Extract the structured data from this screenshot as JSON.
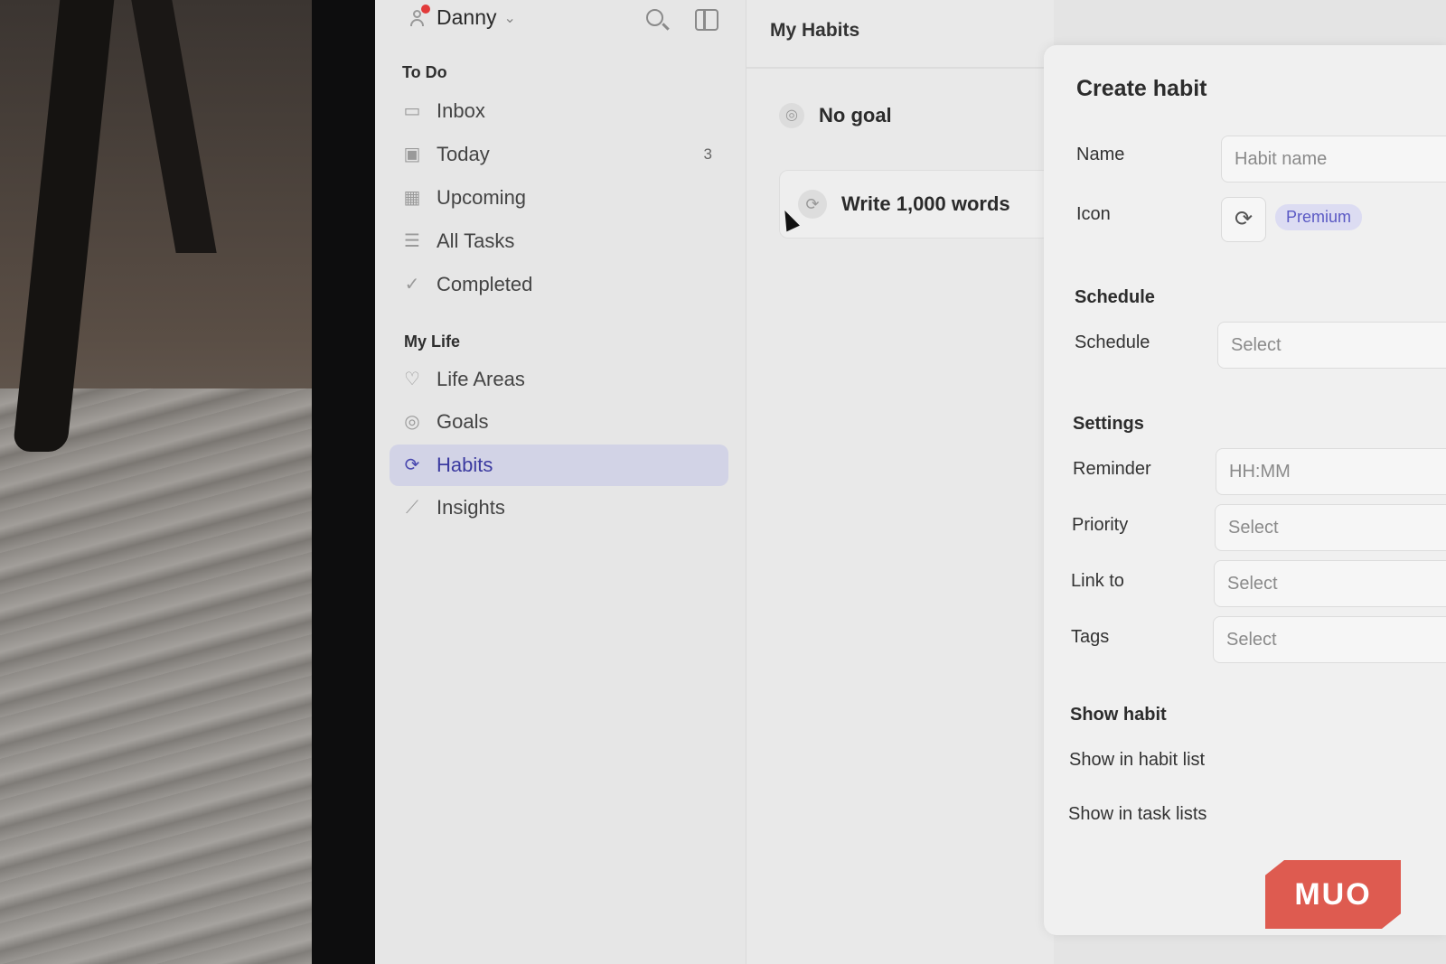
{
  "user": {
    "name": "Danny"
  },
  "sidebar": {
    "todo_title": "To Do",
    "todo_items": [
      {
        "label": "Inbox",
        "icon": "inbox-icon"
      },
      {
        "label": "Today",
        "icon": "calendar-icon",
        "count": "3"
      },
      {
        "label": "Upcoming",
        "icon": "calendar-grid-icon"
      },
      {
        "label": "All Tasks",
        "icon": "list-icon"
      },
      {
        "label": "Completed",
        "icon": "check-circle-icon"
      }
    ],
    "life_title": "My Life",
    "life_items": [
      {
        "label": "Life Areas",
        "icon": "heart-icon"
      },
      {
        "label": "Goals",
        "icon": "target-icon"
      },
      {
        "label": "Habits",
        "icon": "repeat-icon"
      },
      {
        "label": "Insights",
        "icon": "trend-icon"
      }
    ]
  },
  "middle": {
    "title": "My Habits",
    "goal_group": "No goal",
    "habits": [
      "Write 1,000 words"
    ]
  },
  "panel": {
    "title": "Create habit",
    "name_label": "Name",
    "name_placeholder": "Habit name",
    "icon_label": "Icon",
    "premium_badge": "Premium",
    "schedule_section": "Schedule",
    "schedule_label": "Schedule",
    "schedule_value": "Select",
    "settings_section": "Settings",
    "reminder_label": "Reminder",
    "reminder_placeholder": "HH:MM",
    "priority_label": "Priority",
    "priority_value": "Select",
    "link_label": "Link to",
    "link_value": "Select",
    "tags_label": "Tags",
    "tags_value": "Select",
    "show_section": "Show habit",
    "show_habit_list": "Show in habit list",
    "show_task_lists": "Show in task lists"
  },
  "watermark": "MUO",
  "colors": {
    "accent": "#4a49b0",
    "active_bg": "#d2d3e6",
    "premium_text": "#5a59c4",
    "watermark_bg": "#de5b50"
  }
}
